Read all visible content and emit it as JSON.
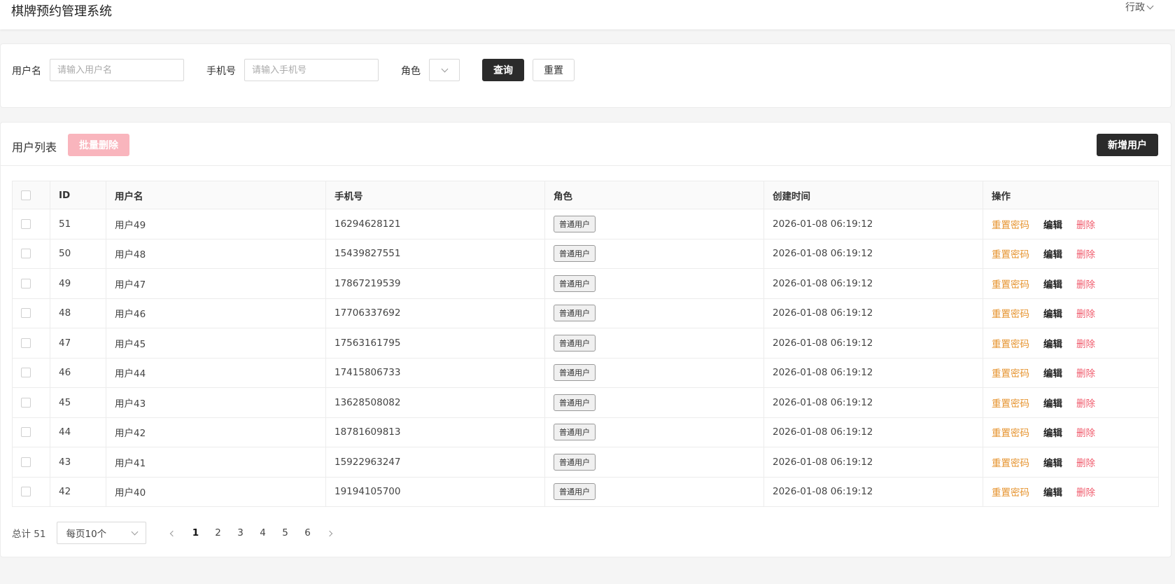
{
  "header": {
    "app_title": "棋牌预约管理系统",
    "user_name": "行政"
  },
  "filters": {
    "username_label": "用户名",
    "username_placeholder": "请输入用户名",
    "phone_label": "手机号",
    "phone_placeholder": "请输入手机号",
    "role_label": "角色",
    "query_label": "查询",
    "reset_label": "重置"
  },
  "list": {
    "title": "用户列表",
    "batch_delete_label": "批量删除",
    "add_user_label": "新增用户",
    "columns": [
      "ID",
      "用户名",
      "手机号",
      "角色",
      "创建时间",
      "操作"
    ],
    "actions": {
      "reset_password": "重置密码",
      "edit": "编辑",
      "delete": "删除"
    },
    "rows": [
      {
        "id": "51",
        "username": "用户49",
        "phone": "16294628121",
        "role": "普通用户",
        "created": "2026-01-08 06:19:12"
      },
      {
        "id": "50",
        "username": "用户48",
        "phone": "15439827551",
        "role": "普通用户",
        "created": "2026-01-08 06:19:12"
      },
      {
        "id": "49",
        "username": "用户47",
        "phone": "17867219539",
        "role": "普通用户",
        "created": "2026-01-08 06:19:12"
      },
      {
        "id": "48",
        "username": "用户46",
        "phone": "17706337692",
        "role": "普通用户",
        "created": "2026-01-08 06:19:12"
      },
      {
        "id": "47",
        "username": "用户45",
        "phone": "17563161795",
        "role": "普通用户",
        "created": "2026-01-08 06:19:12"
      },
      {
        "id": "46",
        "username": "用户44",
        "phone": "17415806733",
        "role": "普通用户",
        "created": "2026-01-08 06:19:12"
      },
      {
        "id": "45",
        "username": "用户43",
        "phone": "13628508082",
        "role": "普通用户",
        "created": "2026-01-08 06:19:12"
      },
      {
        "id": "44",
        "username": "用户42",
        "phone": "18781609813",
        "role": "普通用户",
        "created": "2026-01-08 06:19:12"
      },
      {
        "id": "43",
        "username": "用户41",
        "phone": "15922963247",
        "role": "普通用户",
        "created": "2026-01-08 06:19:12"
      },
      {
        "id": "42",
        "username": "用户40",
        "phone": "19194105700",
        "role": "普通用户",
        "created": "2026-01-08 06:19:12"
      }
    ]
  },
  "pagination": {
    "total_text": "总计 51",
    "page_size_label": "每页10个",
    "pages": [
      "1",
      "2",
      "3",
      "4",
      "5",
      "6"
    ],
    "current_page": "1"
  },
  "colors": {
    "dark_button": "#2b2b2b",
    "disabled_danger": "#f9b5bd",
    "reset_password": "#e6932e",
    "delete": "#f05b6c"
  }
}
